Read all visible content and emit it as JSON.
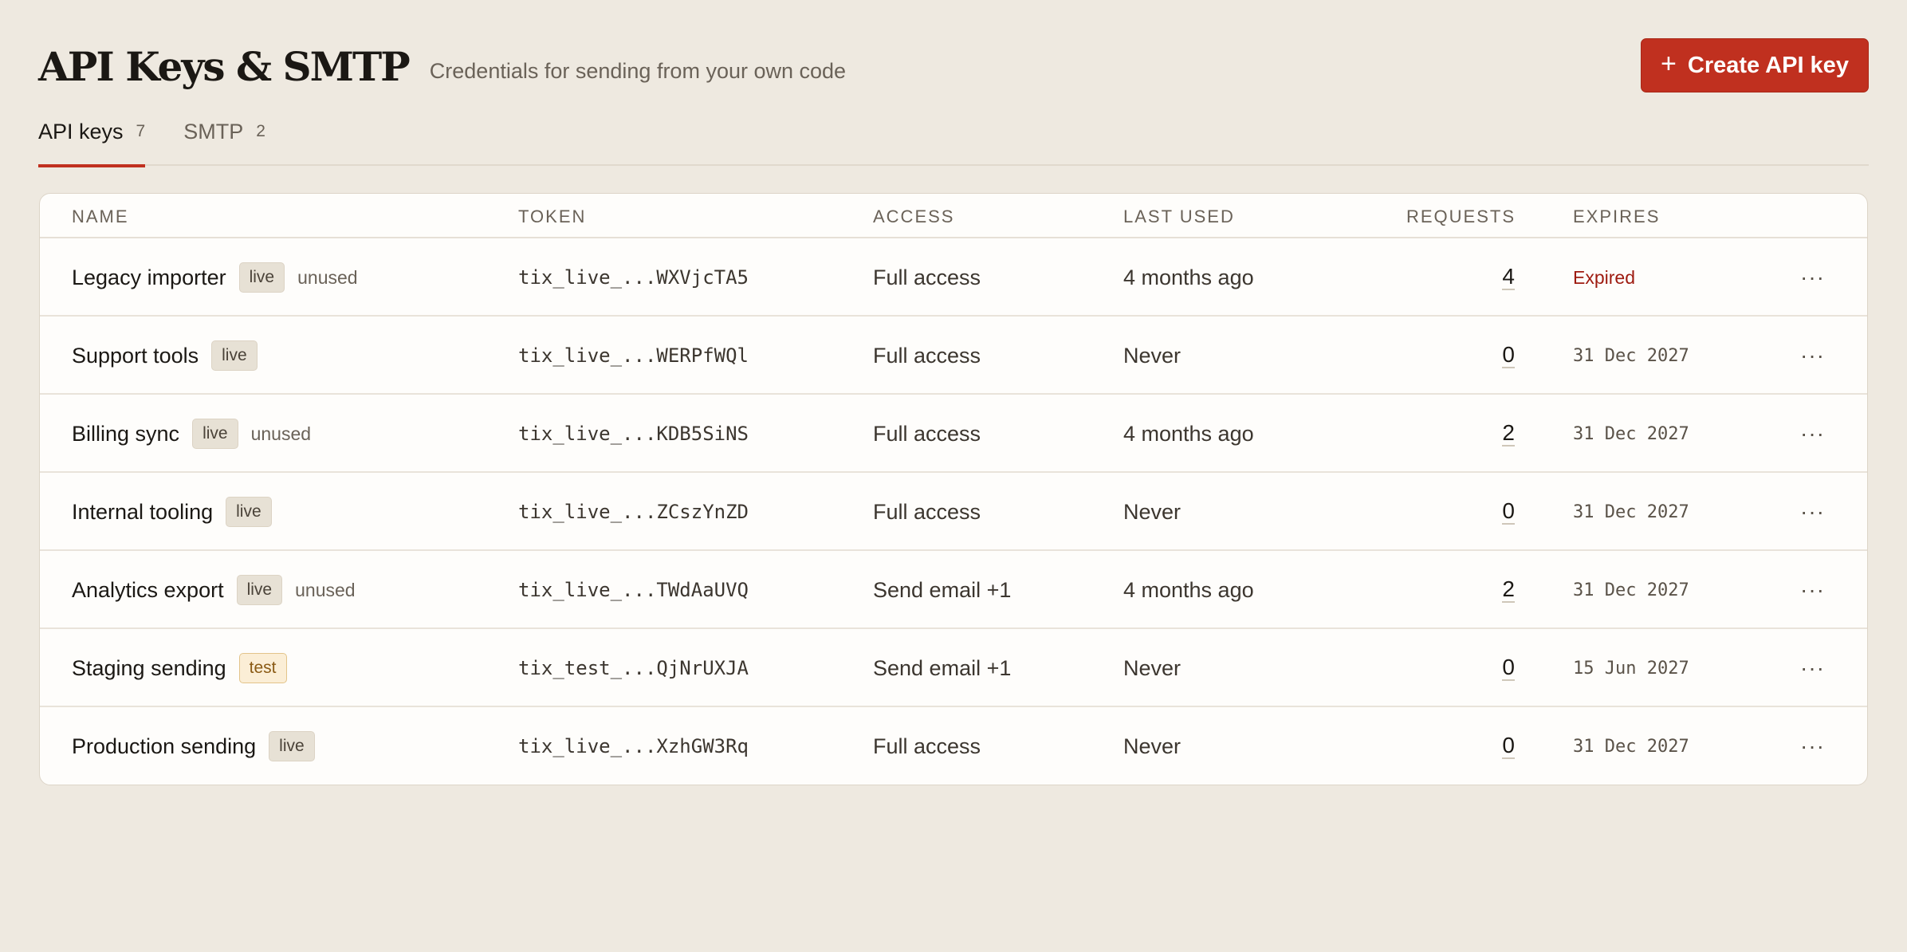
{
  "header": {
    "title": "API Keys & SMTP",
    "subtitle": "Credentials for sending from your own code",
    "create_button": {
      "plus": "+",
      "label": "Create API key"
    }
  },
  "tabs": [
    {
      "label": "API keys",
      "count": "7",
      "active": true
    },
    {
      "label": "SMTP",
      "count": "2",
      "active": false
    }
  ],
  "table": {
    "columns": [
      "NAME",
      "TOKEN",
      "ACCESS",
      "LAST USED",
      "REQUESTS",
      "EXPIRES"
    ],
    "more_glyph": "···",
    "rows": [
      {
        "name": "Legacy importer",
        "badge": "live",
        "unused": "unused",
        "token": "tix_live_...WXVjcTA5",
        "access": "Full access",
        "last_used": "4 months ago",
        "requests": "4",
        "expires": "Expired",
        "expired": true
      },
      {
        "name": "Support tools",
        "badge": "live",
        "unused": "",
        "token": "tix_live_...WERPfWQl",
        "access": "Full access",
        "last_used": "Never",
        "requests": "0",
        "expires": "31 Dec 2027",
        "expired": false
      },
      {
        "name": "Billing sync",
        "badge": "live",
        "unused": "unused",
        "token": "tix_live_...KDB5SiNS",
        "access": "Full access",
        "last_used": "4 months ago",
        "requests": "2",
        "expires": "31 Dec 2027",
        "expired": false
      },
      {
        "name": "Internal tooling",
        "badge": "live",
        "unused": "",
        "token": "tix_live_...ZCszYnZD",
        "access": "Full access",
        "last_used": "Never",
        "requests": "0",
        "expires": "31 Dec 2027",
        "expired": false
      },
      {
        "name": "Analytics export",
        "badge": "live",
        "unused": "unused",
        "token": "tix_live_...TWdAaUVQ",
        "access": "Send email +1",
        "last_used": "4 months ago",
        "requests": "2",
        "expires": "31 Dec 2027",
        "expired": false
      },
      {
        "name": "Staging sending",
        "badge": "test",
        "unused": "",
        "token": "tix_test_...QjNrUXJA",
        "access": "Send email +1",
        "last_used": "Never",
        "requests": "0",
        "expires": "15 Jun 2027",
        "expired": false
      },
      {
        "name": "Production sending",
        "badge": "live",
        "unused": "",
        "token": "tix_live_...XzhGW3Rq",
        "access": "Full access",
        "last_used": "Never",
        "requests": "0",
        "expires": "31 Dec 2027",
        "expired": false
      }
    ]
  },
  "colors": {
    "background": "#eee9e0",
    "accent": "#c0301f",
    "expired": "#9e1b10",
    "test_badge": "#fbeed6"
  }
}
